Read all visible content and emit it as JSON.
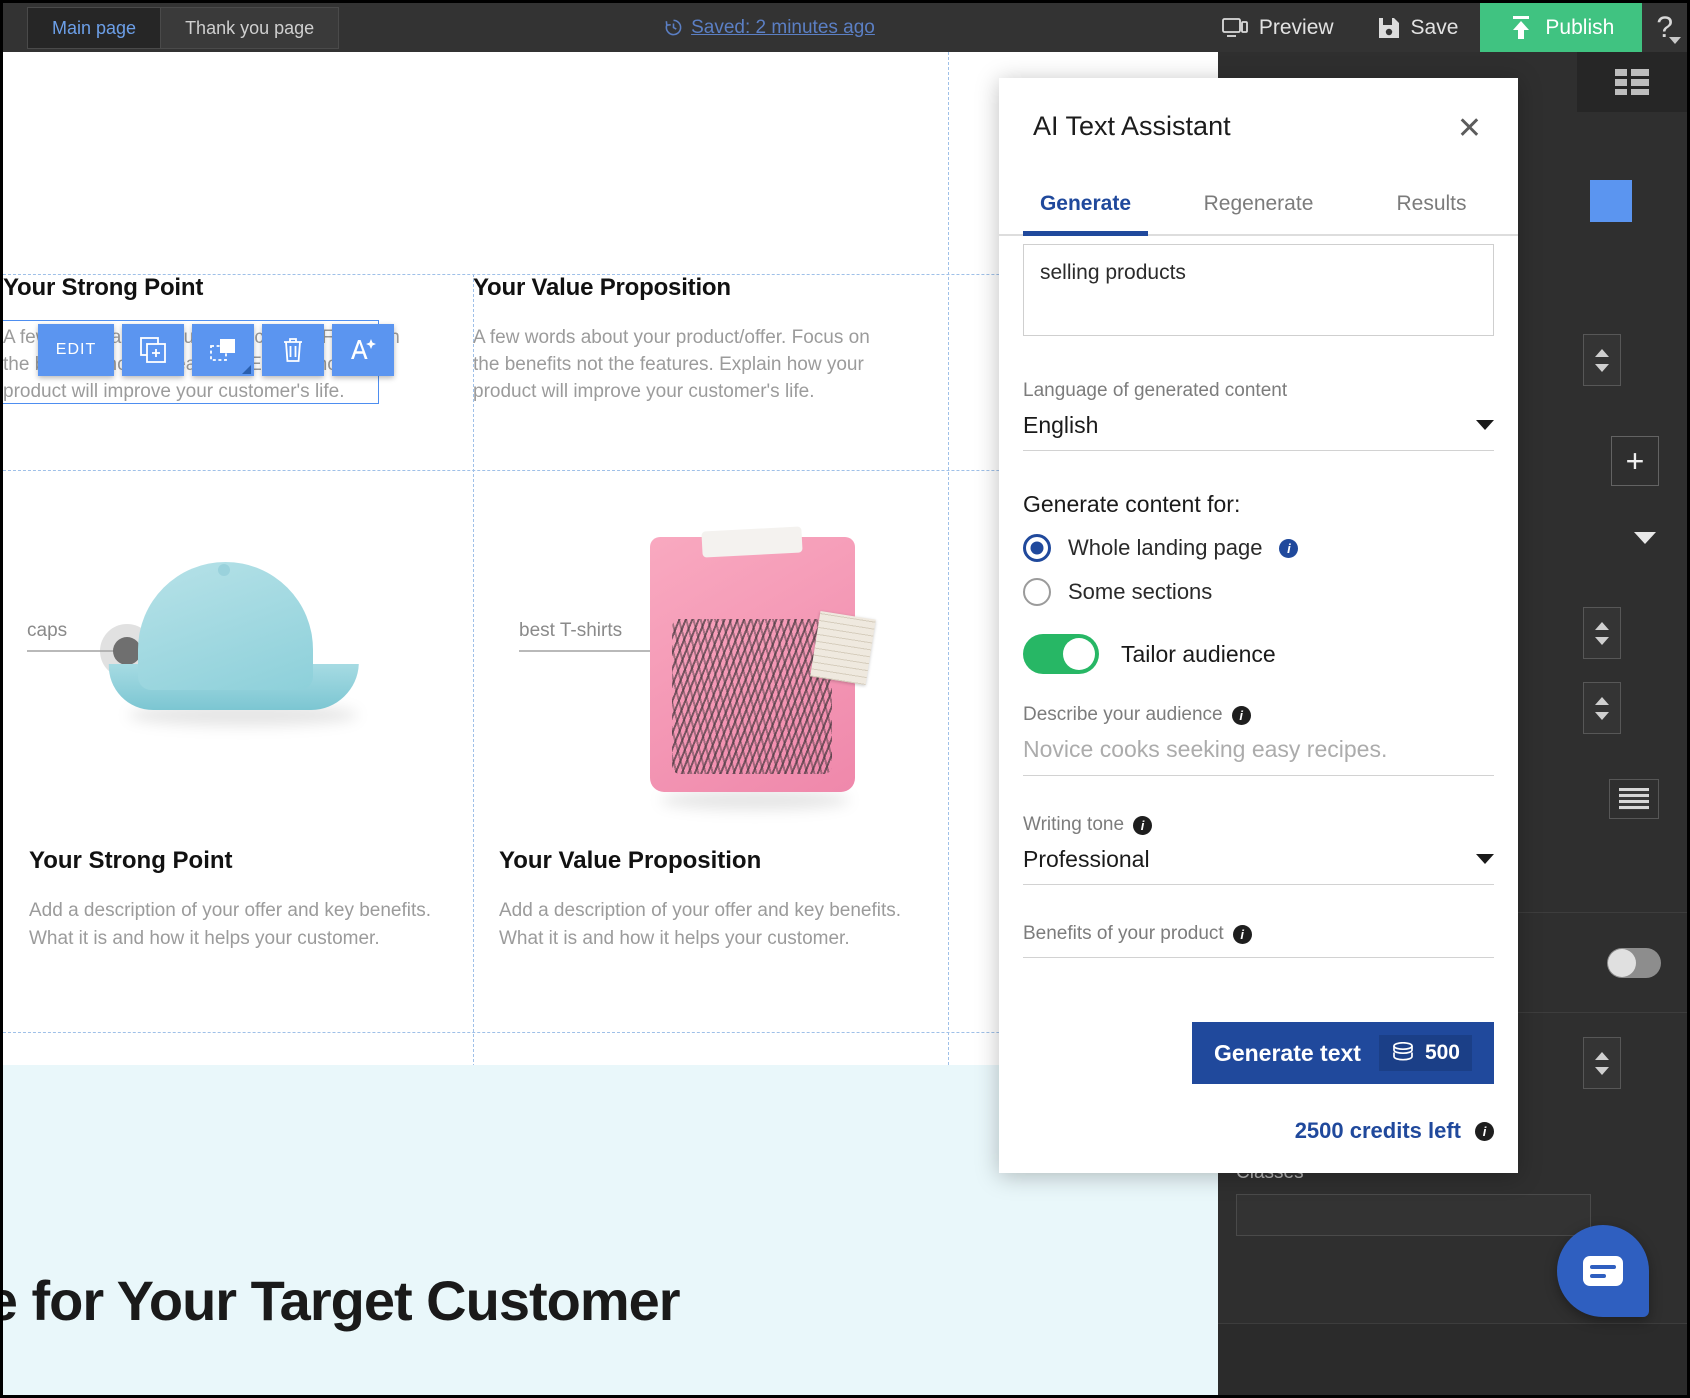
{
  "topbar": {
    "tabs": [
      {
        "label": "Main page",
        "active": true
      },
      {
        "label": "Thank you page",
        "active": false
      }
    ],
    "saved_status": "Saved: 2 minutes ago",
    "preview_label": "Preview",
    "save_label": "Save",
    "publish_label": "Publish",
    "help_label": "?",
    "publish_color": "#40c381",
    "accent_link_color": "#5b7fc4"
  },
  "canvas": {
    "edit_toolbar": [
      {
        "label": "EDIT",
        "icon": "text-edit-icon"
      },
      {
        "label": "",
        "icon": "duplicate-icon"
      },
      {
        "label": "",
        "icon": "resize-icon"
      },
      {
        "label": "",
        "icon": "trash-icon"
      },
      {
        "label": "",
        "icon": "ai-magic-wand-icon"
      }
    ],
    "row_top": [
      {
        "title": "Your Strong Point",
        "body": "A few words about your product/offer. Focus on the benefits not the features. Explain how your product will improve your customer's life."
      },
      {
        "title": "Your Value Proposition",
        "body": "A few words about your product/offer. Focus on the benefits not the features. Explain how your product will improve your customer's life."
      }
    ],
    "row_cards": [
      {
        "tagline": "caps",
        "title": "Your Strong Point",
        "body": "Add a description of your offer and key benefits. What it is and how it helps your customer.",
        "image": "blue-baseball-cap-photo"
      },
      {
        "tagline": "best T-shirts",
        "title": "Your Value Proposition",
        "body": "Add a description of your offer and key benefits. What it is and how it helps your customer.",
        "image": "pink-folded-tshirt-photo"
      }
    ],
    "hero_heading": "lue for Your Target Customer"
  },
  "ai_panel": {
    "title": "AI Text Assistant",
    "close_label": "✕",
    "tabs": [
      {
        "label": "Generate",
        "active": true
      },
      {
        "label": "Regenerate",
        "active": false
      },
      {
        "label": "Results",
        "active": false
      }
    ],
    "prompt_value": "selling products",
    "language_label": "Language of generated content",
    "language_value": "English",
    "generate_for_label": "Generate content for:",
    "radios": [
      {
        "label": "Whole landing page",
        "selected": true,
        "has_info": true
      },
      {
        "label": "Some sections",
        "selected": false,
        "has_info": false
      }
    ],
    "tailor_audience_label": "Tailor audience",
    "tailor_audience_on": true,
    "audience_label": "Describe your audience",
    "audience_placeholder": "Novice cooks seeking easy recipes.",
    "tone_label": "Writing tone",
    "tone_value": "Professional",
    "benefits_label": "Benefits of your product",
    "benefits_value": "",
    "generate_button_label": "Generate text",
    "generate_button_cost": "500",
    "credits_left": "2500 credits left",
    "primary_color": "#20499c",
    "toggle_on_color": "#27b765"
  },
  "right_panel": {
    "classes_label": "Classes",
    "classes_value": "",
    "chat_icon": "chat-bubble-icon"
  }
}
